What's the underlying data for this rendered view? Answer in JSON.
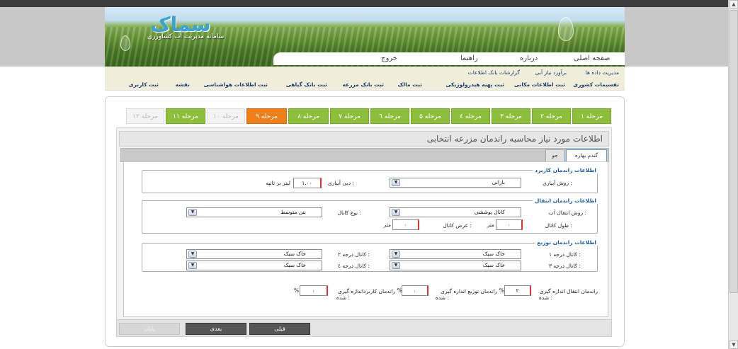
{
  "site": {
    "logo_text": "سماک",
    "logo_subtitle": "سامانه مدیریت آب کشاورزی"
  },
  "main_nav": [
    {
      "label": "صفحه اصلی"
    },
    {
      "label": "درباره"
    },
    {
      "label": "راهنما"
    },
    {
      "label": "خروج"
    }
  ],
  "sub_nav_top": [
    {
      "label": "مدیریت داده ها"
    },
    {
      "label": "برآورد نیاز آبی"
    },
    {
      "label": "گزارشات بانک اطلاعات"
    }
  ],
  "sub_nav_bottom": [
    {
      "label": "تقسیمات کشوری"
    },
    {
      "label": "ثبت اطلاعات مکانی"
    },
    {
      "label": "ثبت پهنه هیدرولوژیکی"
    },
    {
      "label": "ثبت مالک"
    },
    {
      "label": "ثبت بانک مزرعه"
    },
    {
      "label": "ثبت بانک گیاهی"
    },
    {
      "label": "ثبت اطلاعات هواشناسی"
    },
    {
      "label": "نقشه"
    },
    {
      "label": "ثبت کاربری"
    }
  ],
  "steps": [
    {
      "label": "مرحله ۱",
      "state": "done"
    },
    {
      "label": "مرحله ۲",
      "state": "done"
    },
    {
      "label": "مرحله ۳",
      "state": "done"
    },
    {
      "label": "مرحله ٤",
      "state": "done"
    },
    {
      "label": "مرحله ۵",
      "state": "done"
    },
    {
      "label": "مرحله ٦",
      "state": "done"
    },
    {
      "label": "مرحله ۷",
      "state": "done"
    },
    {
      "label": "مرحله ۸",
      "state": "done"
    },
    {
      "label": "مرحله ۹",
      "state": "active"
    },
    {
      "label": "مرحله ۱۰",
      "state": "disabled"
    },
    {
      "label": "مرحله ۱۱",
      "state": "done"
    },
    {
      "label": "مرحله ۱۲",
      "state": "disabled"
    }
  ],
  "form": {
    "title": "اطلاعات مورد نیاز محاسبه راندمان مزرعه انتخابی",
    "tabs": [
      {
        "label": "گندم بهاره",
        "active": true
      },
      {
        "label": "جو",
        "active": false
      }
    ],
    "usage": {
      "legend": "اطلاعات راندمان کاربرد",
      "irrigation_method_label": "روش آبیاری :",
      "irrigation_method_value": "بارانی",
      "flow_label": "دبی آبیاری :",
      "flow_value": "۱.۰۰",
      "flow_unit": "لیتر بر ثانیه"
    },
    "transfer": {
      "legend": "اطلاعات راندمان انتقال",
      "method_label": "روش انتقال آب :",
      "method_value": "کانال پوششی",
      "channel_type_label": "نوع کانال :",
      "channel_type_value": "بتن متوسط",
      "length_label": "طول کانال :",
      "length_value": "۰",
      "length_unit": "متر",
      "width_label": "عرض کانال :",
      "width_value": "۰",
      "width_unit": "متر"
    },
    "distribution": {
      "legend": "اطلاعات راندمان توزیع",
      "ch1_label": "کانال درجه ۱ :",
      "ch1_value": "خاک سبک",
      "ch2_label": "کانال درجه ۲ :",
      "ch2_value": "خاک سبک",
      "ch3_label": "کانال درجه ۳ :",
      "ch3_value": "خاک سبک",
      "ch4_label": "کانال درجه ٤ :",
      "ch4_value": "خاک سبک"
    },
    "measured": {
      "transfer_label_1": "راندمان انتقال اندازه گیری",
      "transfer_label_2": "شده :",
      "transfer_value": "۲",
      "distribution_label_1": "راندمان توزیع اندازه گیری",
      "distribution_label_2": "شده :",
      "distribution_value": "۰",
      "usage_label_1": "راندمان کاربرداندازه گیری",
      "usage_label_2": "شده :",
      "usage_value": "۰",
      "percent": "%"
    }
  },
  "buttons": {
    "prev": "قبلی",
    "next": "بعدی",
    "finish": "پایان"
  },
  "colors": {
    "step_done": "#8dbf3d",
    "step_active": "#ef7f1a",
    "legend_blue": "#1f5ea8",
    "nav_link": "#1c3b6e"
  }
}
